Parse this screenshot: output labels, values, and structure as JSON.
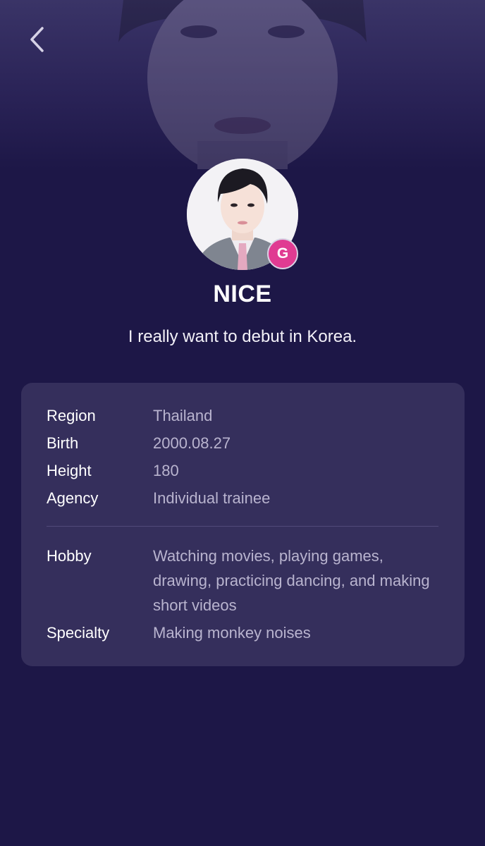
{
  "nav": {
    "back_icon": "chevron-left-icon"
  },
  "profile": {
    "name": "NICE",
    "intro": "I really want to debut in Korea.",
    "grade_badge": "G",
    "grade_color": "#e03b92"
  },
  "info": {
    "region_label": "Region",
    "region_value": "Thailand",
    "birth_label": "Birth",
    "birth_value": "2000.08.27",
    "height_label": "Height",
    "height_value": "180",
    "agency_label": "Agency",
    "agency_value": "Individual trainee",
    "hobby_label": "Hobby",
    "hobby_value": "Watching movies, playing games, drawing, practicing dancing, and making short videos",
    "specialty_label": "Specialty",
    "specialty_value": "Making monkey noises"
  },
  "colors": {
    "background": "#1d1747",
    "card": "#352f5c",
    "value_text": "#b9b4cf"
  }
}
